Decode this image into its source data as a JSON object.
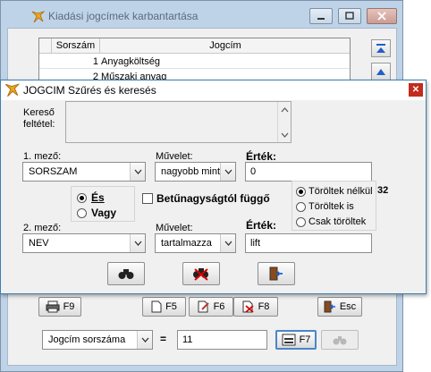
{
  "main_window": {
    "title": "Kiadási jogcímek karbantartása",
    "list": {
      "columns": [
        "Sorszám",
        "Jogcím"
      ],
      "rows": [
        {
          "num": "1",
          "name": "Anyagköltség"
        },
        {
          "num": "2",
          "name": "Műszaki anyag"
        }
      ]
    },
    "toolbar": {
      "print_label": "F9",
      "new_label": "F5",
      "edit_label": "F6",
      "delete_label": "F8",
      "exit_label": "Esc"
    },
    "search": {
      "field": "Jogcím sorszáma",
      "operator": "=",
      "value": "11",
      "filter_label": "F7"
    }
  },
  "filter_dialog": {
    "title": "JOGCIM Szűrés és keresés",
    "criteria_label_1": "Kereső",
    "criteria_label_2": "feltétel:",
    "criteria_text": "",
    "field1": {
      "label": "1. mező:",
      "value": "SORSZAM"
    },
    "op1": {
      "label": "Művelet:",
      "value": "nagyobb mint"
    },
    "val1": {
      "label": "Érték:",
      "value": "0"
    },
    "logic": {
      "and_label": "És",
      "or_label": "Vagy",
      "selected": "and"
    },
    "case_sensitive_label": "Betűnagyságtól függő",
    "deleted": {
      "options": [
        "Töröltek nélkül",
        "Töröltek is",
        "Csak töröltek"
      ],
      "selected": 0,
      "count": "32"
    },
    "field2": {
      "label": "2. mező:",
      "value": "NEV"
    },
    "op2": {
      "label": "Művelet:",
      "value": "tartalmazza"
    },
    "val2": {
      "label": "Érték:",
      "value": "lift"
    }
  },
  "colors": {
    "window_frame": "#bfd3e8",
    "dialog_border": "#3c7fb1",
    "close_red": "#c42b1c",
    "nav_blue": "#1f5fc9"
  }
}
